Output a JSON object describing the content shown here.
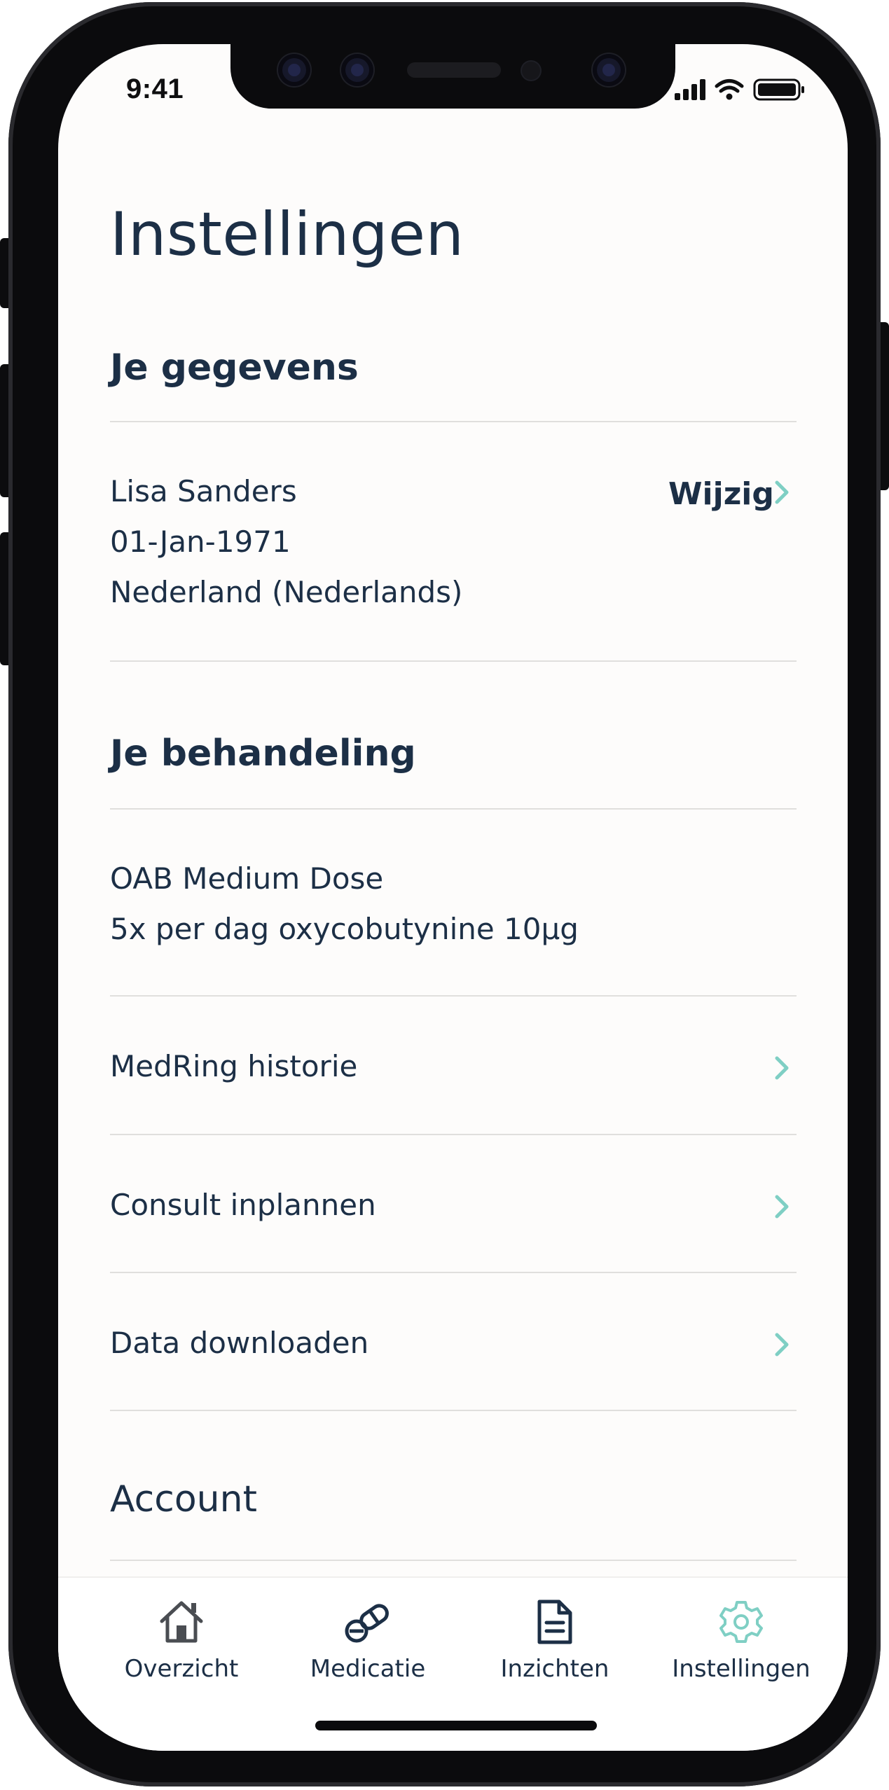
{
  "status_bar": {
    "time": "9:41"
  },
  "header": {
    "title": "Instellingen"
  },
  "personal": {
    "section_title": "Je gegevens",
    "name": "Lisa Sanders",
    "birthdate": "01-Jan-1971",
    "country_language": "Nederland (Nederlands)",
    "edit_label": "Wijzig"
  },
  "treatment": {
    "section_title": "Je behandeling",
    "plan_name": "OAB Medium Dose",
    "plan_detail": "5x per dag oxycobutynine 10μg",
    "links": [
      {
        "label": "MedRing historie"
      },
      {
        "label": "Consult inplannen"
      },
      {
        "label": "Data downloaden"
      }
    ]
  },
  "account": {
    "section_title": "Account"
  },
  "tabbar": {
    "tabs": [
      {
        "label": "Overzicht",
        "icon": "home-icon"
      },
      {
        "label": "Medicatie",
        "icon": "pill-icon"
      },
      {
        "label": "Inzichten",
        "icon": "document-icon"
      },
      {
        "label": "Instellingen",
        "icon": "gear-icon",
        "active": true
      }
    ]
  },
  "colors": {
    "text": "#1c2f46",
    "accent": "#7fcfc4",
    "divider": "#e0dfdd",
    "background": "#fdfcfb"
  }
}
